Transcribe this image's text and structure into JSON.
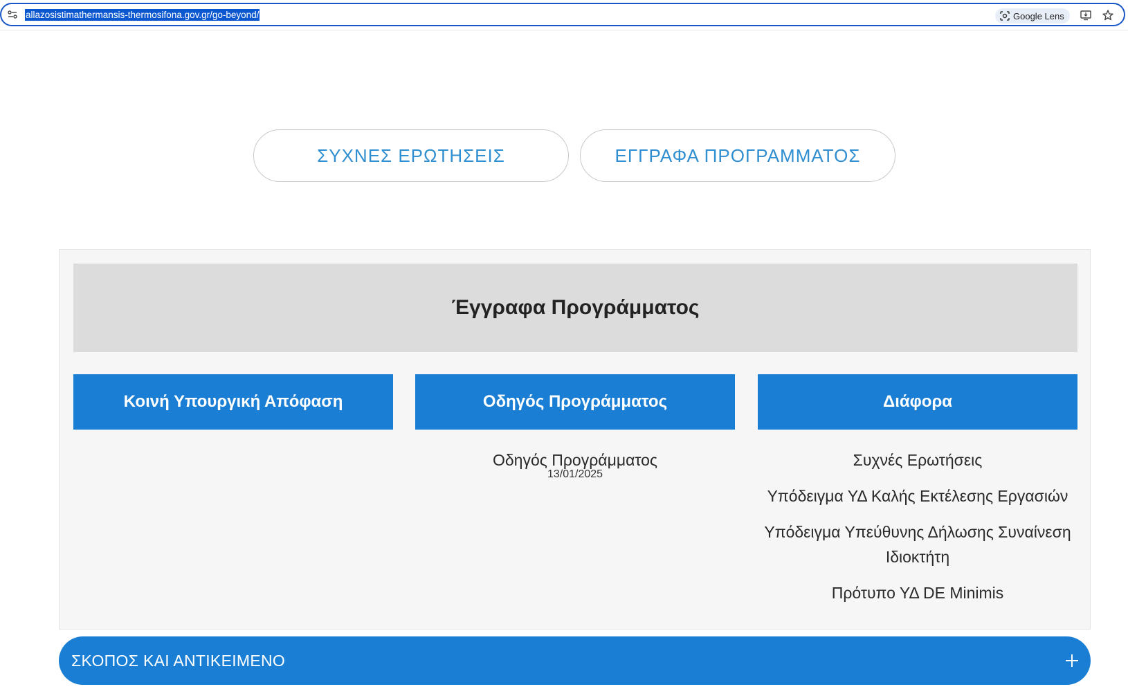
{
  "browser": {
    "url": "allazosistimathermansis-thermosifona.gov.gr/go-beyond/",
    "lens_label": "Google Lens"
  },
  "buttons": {
    "faq": "ΣΥΧΝΕΣ ΕΡΩΤΗΣΕΙΣ",
    "documents": "ΕΓΓΡΑΦΑ ΠΡΟΓΡΑΜΜΑΤΟΣ"
  },
  "documents_section": {
    "title": "Έγγραφα Προγράμματος",
    "columns": [
      {
        "heading": "Κοινή Υπουργική Απόφαση",
        "items": []
      },
      {
        "heading": "Οδηγός Προγράμματος",
        "items": [
          {
            "label": "Οδηγός Προγράμματος",
            "date": "13/01/2025"
          }
        ]
      },
      {
        "heading": "Διάφορα",
        "items": [
          {
            "label": "Συχνές Ερωτήσεις"
          },
          {
            "label": "Υπόδειγμα ΥΔ Καλής Εκτέλεσης Εργασιών"
          },
          {
            "label": "Υπόδειγμα Υπεύθυνης Δήλωσης Συναίνεση Ιδιοκτήτη"
          },
          {
            "label": "Πρότυπο ΥΔ DE Minimis"
          }
        ]
      }
    ]
  },
  "accordion": {
    "title": "ΣΚΟΠΟΣ ΚΑΙ ΑΝΤΙΚΕΙΜΕΝΟ"
  },
  "colors": {
    "accent": "#1a7fd4",
    "pill_text": "#2f8fd0",
    "header_bg": "#dcdcdc"
  }
}
